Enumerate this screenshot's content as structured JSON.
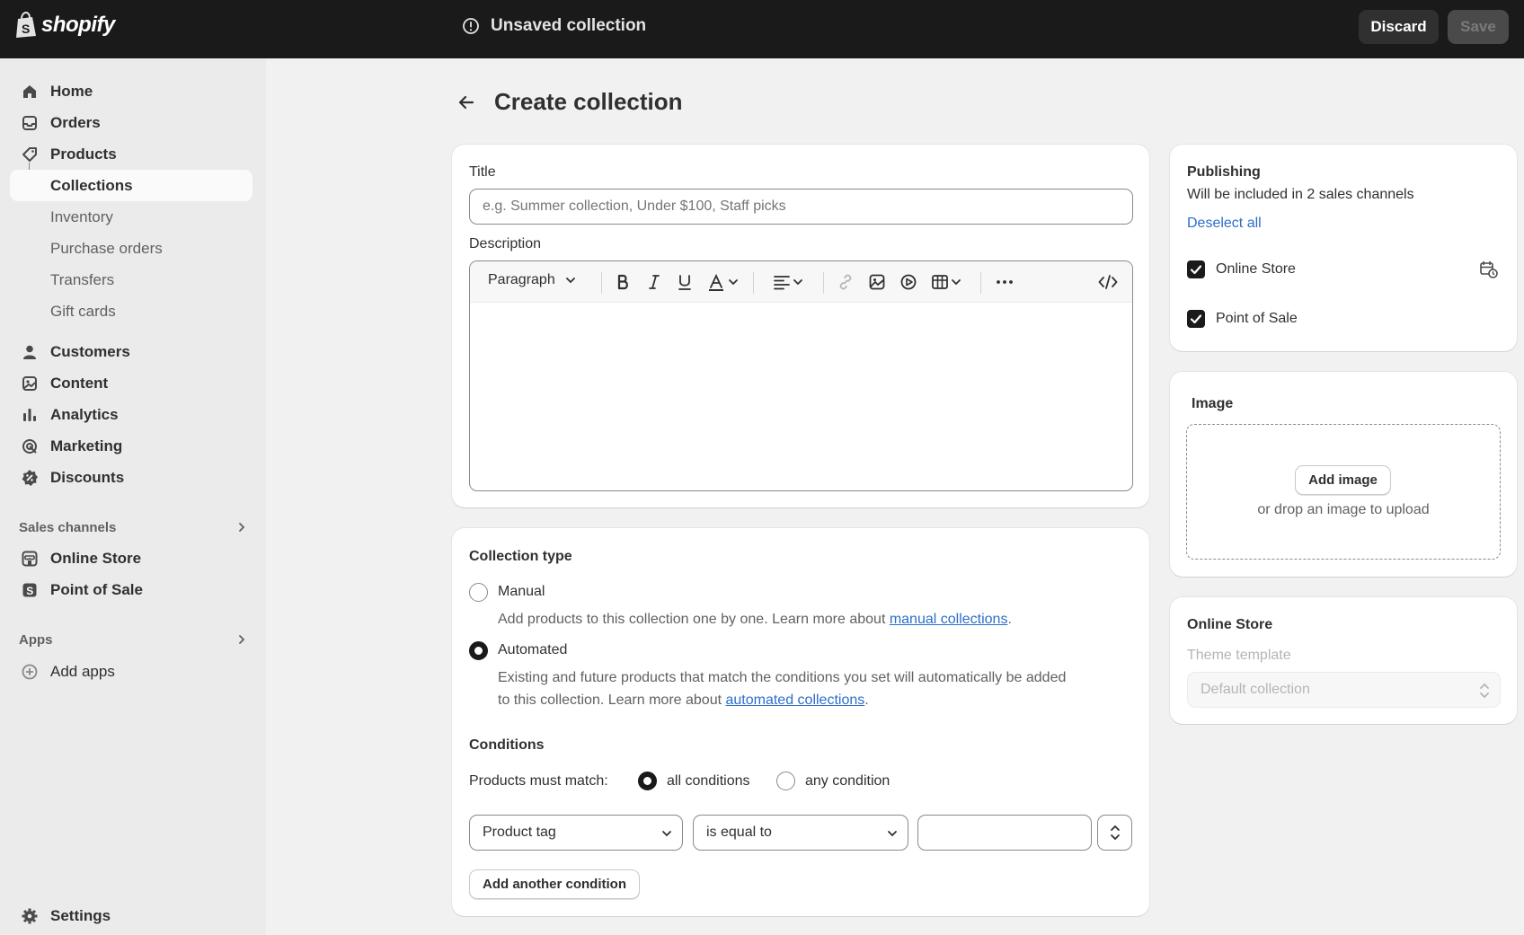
{
  "topbar": {
    "logo_text": "shopify",
    "status_text": "Unsaved collection",
    "discard_label": "Discard",
    "save_label": "Save"
  },
  "sidebar": {
    "items": [
      {
        "label": "Home",
        "icon": "home-icon"
      },
      {
        "label": "Orders",
        "icon": "orders-icon"
      },
      {
        "label": "Products",
        "icon": "tag-icon"
      },
      {
        "label": "Collections"
      },
      {
        "label": "Inventory"
      },
      {
        "label": "Purchase orders"
      },
      {
        "label": "Transfers"
      },
      {
        "label": "Gift cards"
      },
      {
        "label": "Customers",
        "icon": "person-icon"
      },
      {
        "label": "Content",
        "icon": "content-icon"
      },
      {
        "label": "Analytics",
        "icon": "bar-chart-icon"
      },
      {
        "label": "Marketing",
        "icon": "target-icon"
      },
      {
        "label": "Discounts",
        "icon": "discount-icon"
      }
    ],
    "sales_channels_heading": "Sales channels",
    "channels": [
      {
        "label": "Online Store",
        "icon": "store-icon"
      },
      {
        "label": "Point of Sale",
        "icon": "pos-icon"
      }
    ],
    "apps_heading": "Apps",
    "add_apps_label": "Add apps",
    "settings_label": "Settings"
  },
  "page": {
    "title": "Create collection"
  },
  "details": {
    "title_label": "Title",
    "title_placeholder": "e.g. Summer collection, Under $100, Staff picks",
    "description_label": "Description",
    "paragraph_style": "Paragraph"
  },
  "collection_type": {
    "heading": "Collection type",
    "manual_label": "Manual",
    "manual_help_prefix": "Add products to this collection one by one. Learn more about ",
    "manual_link": "manual collections",
    "automated_label": "Automated",
    "automated_help_line1": "Existing and future products that match the conditions you set will automatically be added",
    "automated_help_prefix": "to this collection. Learn more about ",
    "automated_link": "automated collections",
    "selected": "Automated"
  },
  "conditions": {
    "heading": "Conditions",
    "match_label": "Products must match:",
    "all_label": "all conditions",
    "any_label": "any condition",
    "selected_match": "all conditions",
    "field_value": "Product tag",
    "operator_value": "is equal to",
    "value_text": "",
    "add_label": "Add another condition"
  },
  "publishing": {
    "heading": "Publishing",
    "subtext": "Will be included in 2 sales channels",
    "deselect_label": "Deselect all",
    "channels": [
      {
        "label": "Online Store",
        "checked": true
      },
      {
        "label": "Point of Sale",
        "checked": true
      }
    ]
  },
  "image": {
    "heading": "Image",
    "add_label": "Add image",
    "drop_text": "or drop an image to upload"
  },
  "online_store": {
    "heading": "Online Store",
    "template_label": "Theme template",
    "template_value": "Default collection"
  },
  "colors": {
    "topbar": "#1a1a1a",
    "accent_link": "#2c6ecb",
    "sidebar_bg": "#ebebeb",
    "page_bg": "#f1f1f1"
  }
}
